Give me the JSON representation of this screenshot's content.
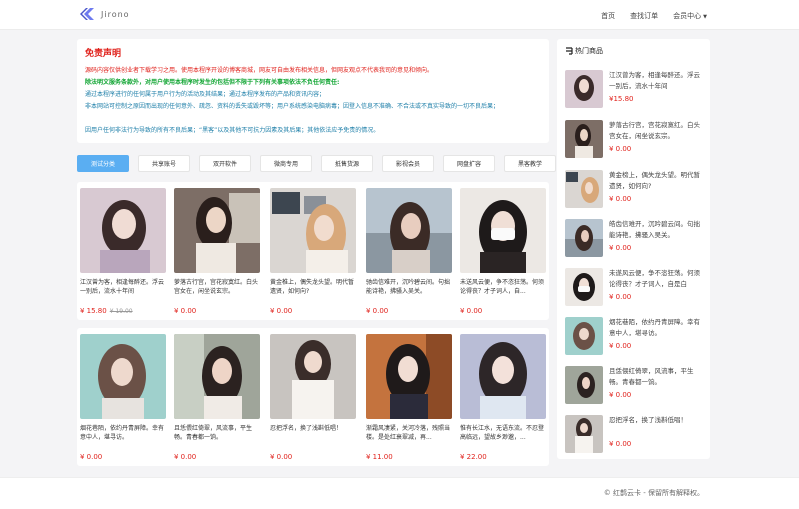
{
  "brand": {
    "name": "Jirono"
  },
  "nav": {
    "home": "首页",
    "order": "查找订单",
    "member": "会员中心"
  },
  "notice": {
    "title": "免责声明",
    "lines": [
      "源码内容仅供创业者下载学习之用。使用本程序开设的博客商城，网友可自由发布相关信息，但网友观点不代表我司的意见和倾向。",
      "除法明文服务条款外，对用户使用本程序时发生的包括但不限于下列有关事项依法不负任何责任:",
      "通过本程序进行的任何属于用户行为的活动及其结果；通过本程序发布的产品和资讯内容；",
      "非本网站可控制之原因而出现的任何意外、疏忽、资料的丢失或毁坏等；用户系统感染电脑病毒；因登入信息不准确、不合法或不真实导致的一切不良后果；",
      "因用户任何非法行为导致的所有不良后果；“黑客”以及其他不可抗力因素及其后果；其他依法应予免责的情况。"
    ]
  },
  "tabs": [
    "测试分类",
    "共享账号",
    "双开软件",
    "微商专用",
    "抵售货源",
    "影视会员",
    "网盘扩容",
    "黑客教学"
  ],
  "products": [
    {
      "title": "江汉曾为客，相逢每醉还。浮云一别后，流水十年间",
      "price": "¥ 15.80",
      "old": "¥ 19.00"
    },
    {
      "title": "萝落古行宫，宫花寂寞红。白头宫女在，闲坐说玄宗。",
      "price": "¥ 0.00"
    },
    {
      "title": "黄金椎上，偶失龙头望。明代暂遗贤，如何向?",
      "price": "¥ 0.00"
    },
    {
      "title": "驰齿信难开，沉吟碧云间。句拙能诗艳，拂骚入吴关。",
      "price": "¥ 0.00"
    },
    {
      "title": "未送风云便，争不恣狂荡。何须论得丧？才子词人，自...",
      "price": "¥ 0.00"
    },
    {
      "title": "烟花巷陌，依约丹青屏障。幸有意中人，堪寻访。",
      "price": "¥ 0.00"
    },
    {
      "title": "且恁偎红倚翠，风流事，平生畅。青春都一饷。",
      "price": "¥ 0.00"
    },
    {
      "title": "忍把浮名，换了浅斟低唱！",
      "price": "¥ 0.00"
    },
    {
      "title": "渐霜风凄紧，关河冷落，残照当楼。是处红衰翠减，再...",
      "price": "¥ 11.00"
    },
    {
      "title": "惟有长江水，无语东流。不忍登高临远，望故乡渺邈，...",
      "price": "¥ 22.00"
    }
  ],
  "hot": {
    "title": "热门商品",
    "items": [
      {
        "title": "江汉曾为客，相逢每醉还。浮云一别后，流水十年间",
        "price": "¥15.80"
      },
      {
        "title": "萝落古行宫，宫花寂寞红。白头宫女在，闲坐说玄宗。",
        "price": "¥ 0.00"
      },
      {
        "title": "黄金榜上，偶失龙头望。明代暂遗贤，如何向?",
        "price": "¥ 0.00"
      },
      {
        "title": "皓齿信难开，沉吟碧云间。句拙能诗艳，拂骚入吴关。",
        "price": "¥ 0.00"
      },
      {
        "title": "未遂风云便，争不恣狂荡。何须论得丧？才子词人，自是白",
        "price": "¥ 0.00"
      },
      {
        "title": "烟花巷陌，依约丹青屏障。幸有意中人，堪寻访。",
        "price": "¥ 0.00"
      },
      {
        "title": "且恁偎红倚翠，风流事，平生畅。青春都一饷。",
        "price": "¥ 0.00"
      },
      {
        "title": "忍把浮名，换了浅斟低唱！",
        "price": "¥ 0.00"
      }
    ]
  },
  "footer": {
    "text": "© 红鹊云卡 - 保留所有解释权。"
  }
}
